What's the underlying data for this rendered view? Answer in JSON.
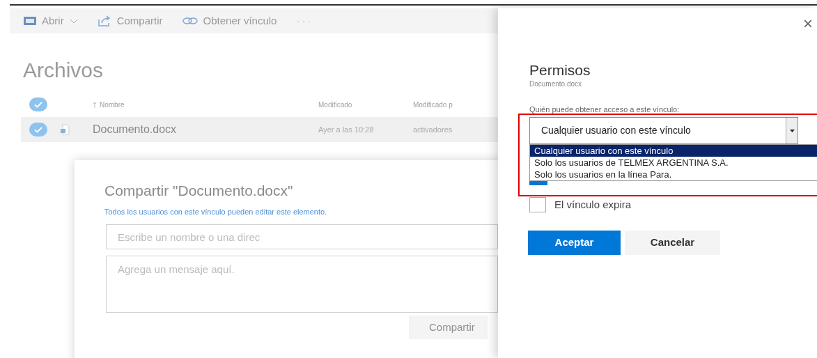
{
  "toolbar": {
    "items": [
      {
        "kind": "open",
        "label": "Abrir"
      },
      {
        "kind": "share",
        "label": "Compartir"
      },
      {
        "kind": "link",
        "label": "Obtener vínculo"
      },
      {
        "kind": "more",
        "label": "···"
      }
    ]
  },
  "files": {
    "title": "Archivos",
    "columns": [
      "Nombre",
      "Modificado",
      "Modificado p"
    ],
    "all_selected": true,
    "rows": [
      {
        "name": "Documento.docx",
        "modified": "Ayer a las 10:28",
        "modified_by": "activadores",
        "selected": true
      }
    ]
  },
  "share_dialog": {
    "title": "Compartir \"Documento.docx\"",
    "link_note": "Todos los usuarios con este vínculo pueden editar este elemento.",
    "name_field": {
      "placeholder": "Escribe un nombre o una direc"
    },
    "message_field": {
      "placeholder": "Agrega un mensaje aquí."
    },
    "share_button": {
      "label": "Compartir",
      "disabled": true
    }
  },
  "permissions_panel": {
    "close": "×",
    "title": "Permisos",
    "subtitle": "Documento.docx",
    "access_label": "Quién puede obtener acceso a este vínculo:",
    "access_select": {
      "value": "Cualquier usuario con este vínculo",
      "expanded": true,
      "options": [
        {
          "label": "Cualquier usuario con este vínculo",
          "selected": true
        },
        {
          "label": "Solo los usuarios de TELMEX ARGENTINA S.A.",
          "selected": false
        },
        {
          "label": "Solo los usuarios en la línea Para.",
          "selected": false
        }
      ]
    },
    "options": [
      {
        "checked": true
      },
      {
        "label": "El vínculo expira",
        "checked": false
      }
    ],
    "buttons": [
      {
        "kind": "primary",
        "label": "Aceptar"
      },
      {
        "kind": "secondary",
        "label": "Cancelar"
      }
    ]
  }
}
